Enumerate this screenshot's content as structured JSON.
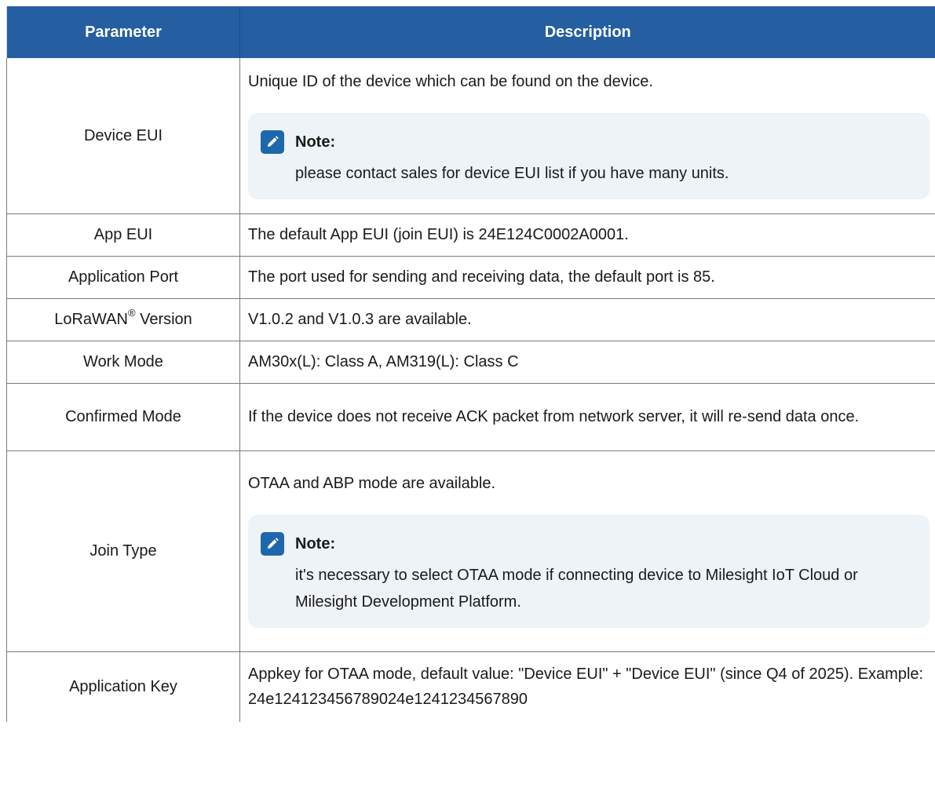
{
  "table": {
    "headers": {
      "parameter": "Parameter",
      "description": "Description"
    },
    "rows": [
      {
        "param": "Device EUI",
        "desc": "Unique ID of the device which can be found on the device.",
        "note_title": "Note:",
        "note_text": "please contact sales for device EUI list if you have many units."
      },
      {
        "param": "App EUI",
        "desc": "The default App EUI (join EUI) is 24E124C0002A0001."
      },
      {
        "param": "Application Port",
        "desc": "The port used for sending and receiving data, the default port is 85."
      },
      {
        "param_main": "LoRaWAN",
        "param_sup": "®",
        "param_tail": " Version",
        "desc": "V1.0.2 and V1.0.3 are available."
      },
      {
        "param": "Work Mode",
        "desc": "AM30x(L): Class A, AM319(L): Class C"
      },
      {
        "param": "Confirmed Mode",
        "desc": "If the device does not receive ACK packet from network server, it will re-send data once."
      },
      {
        "param": "Join Type",
        "desc": "OTAA and ABP mode are available.",
        "note_title": "Note:",
        "note_text": "it's necessary to select OTAA mode if connecting device to Milesight IoT Cloud or Milesight Development Platform."
      },
      {
        "param": "Application Key",
        "desc": "Appkey for OTAA mode, default value: \"Device EUI\" + \"Device EUI\" (since Q4 of 2025). Example: 24e124123456789024e1241234567890"
      }
    ]
  },
  "icons": {
    "note": "pencil-note-icon"
  },
  "colors": {
    "header_bg": "#255ea1",
    "note_bg": "#eef3f7",
    "note_icon_bg": "#1f67ad"
  }
}
